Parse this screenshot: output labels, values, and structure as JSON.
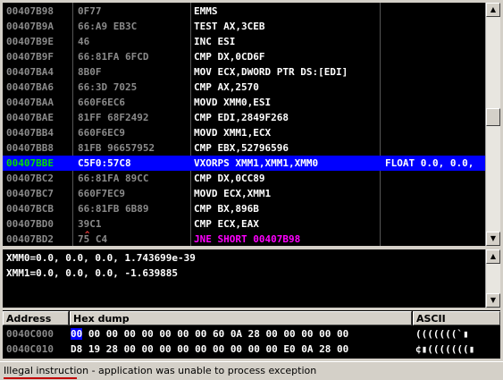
{
  "disasm": {
    "rows": [
      {
        "addr": "00407B98",
        "hex": "0F77",
        "ins": "EMMS",
        "cmt": "",
        "cls": ""
      },
      {
        "addr": "00407B9A",
        "hex": "66:A9 EB3C",
        "ins": "TEST AX,3CEB",
        "cmt": "",
        "cls": ""
      },
      {
        "addr": "00407B9E",
        "hex": "46",
        "ins": "INC ESI",
        "cmt": "",
        "cls": ""
      },
      {
        "addr": "00407B9F",
        "hex": "66:81FA 6FCD",
        "ins": "CMP DX,0CD6F",
        "cmt": "",
        "cls": ""
      },
      {
        "addr": "00407BA4",
        "hex": "8B0F",
        "ins": "MOV ECX,DWORD PTR DS:[EDI]",
        "cmt": "",
        "cls": ""
      },
      {
        "addr": "00407BA6",
        "hex": "66:3D 7025",
        "ins": "CMP AX,2570",
        "cmt": "",
        "cls": ""
      },
      {
        "addr": "00407BAA",
        "hex": "660F6EC6",
        "ins": "MOVD XMM0,ESI",
        "cmt": "",
        "cls": ""
      },
      {
        "addr": "00407BAE",
        "hex": "81FF 68F2492",
        "ins": "CMP EDI,2849F268",
        "cmt": "",
        "cls": ""
      },
      {
        "addr": "00407BB4",
        "hex": "660F6EC9",
        "ins": "MOVD XMM1,ECX",
        "cmt": "",
        "cls": ""
      },
      {
        "addr": "00407BB8",
        "hex": "81FB 96657952",
        "ins": "CMP EBX,52796596",
        "cmt": "",
        "cls": ""
      },
      {
        "addr": "00407BBE",
        "hex": "C5F0:57C8",
        "ins": "VXORPS XMM1,XMM1,XMM0",
        "cmt": "FLOAT 0.0, 0.0,",
        "cls": "sel cur"
      },
      {
        "addr": "00407BC2",
        "hex": "66:81FA 89CC",
        "ins": "CMP DX,0CC89",
        "cmt": "",
        "cls": ""
      },
      {
        "addr": "00407BC7",
        "hex": "660F7EC9",
        "ins": "MOVD ECX,XMM1",
        "cmt": "",
        "cls": ""
      },
      {
        "addr": "00407BCB",
        "hex": "66:81FB 6B89",
        "ins": "CMP BX,896B",
        "cmt": "",
        "cls": ""
      },
      {
        "addr": "00407BD0",
        "hex": "39C1",
        "ins": "CMP ECX,EAX",
        "cmt": "",
        "cls": ""
      },
      {
        "addr": "00407BD2",
        "hex": "75 C4",
        "ins": "JNE SHORT 00407B98",
        "cmt": "",
        "cls": "jmp"
      }
    ],
    "jump_marker": "^",
    "jump_color": "#ff00ff"
  },
  "registers": {
    "xmm0": "XMM0=0.0, 0.0, 0.0, 1.743699e-39",
    "xmm1": "XMM1=0.0, 0.0, 0.0, -1.639885"
  },
  "dump": {
    "headers": {
      "address": "Address",
      "hex": "Hex dump",
      "ascii": "ASCII"
    },
    "rows": [
      {
        "addr": "0040C000",
        "first": "00",
        "bytes": " 00 00 00 00 00 00 00 60 0A 28 00 00 00 00 00",
        "ascii": "(((((((`▮"
      },
      {
        "addr": "0040C010",
        "first": "D8",
        "bytes": " 19 28 00 00 00 00 00 00 00 00 00 E0 0A 28 00",
        "ascii": "¢▮(((((((▮"
      }
    ]
  },
  "status": {
    "text": "Illegal instruction - application was unable to process exception"
  },
  "colors": {
    "selection": "#0000ff",
    "current_addr": "#00e000",
    "status_underline": "#c00000"
  }
}
